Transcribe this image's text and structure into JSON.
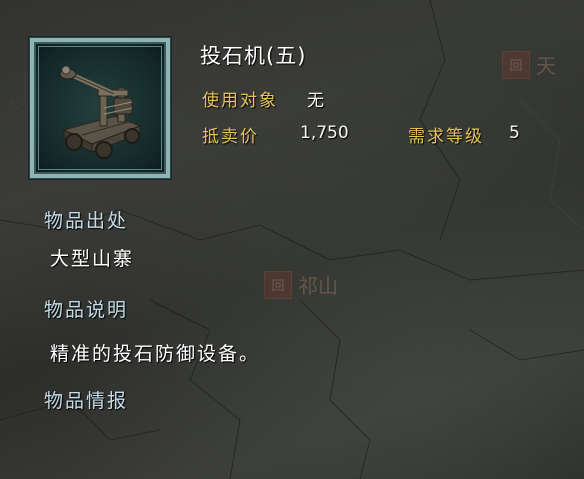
{
  "item": {
    "title": "投石机(五)",
    "icon": "catapult-icon",
    "target_label": "使用对象",
    "target_value": "无",
    "price_label": "抵卖价",
    "price_value": "1,750",
    "level_label": "需求等级",
    "level_value": "5"
  },
  "sections": {
    "origin_heading": "物品出处",
    "origin_value": "大型山寨",
    "desc_heading": "物品说明",
    "desc_value": "精准的投石防御设备。",
    "info_heading": "物品情报"
  },
  "background": {
    "marker_top_right": "天",
    "marker_mid": "祁山"
  },
  "colors": {
    "gold": "#e6c35a",
    "heading": "#c4dde8",
    "frame": "#8fb4b4"
  }
}
